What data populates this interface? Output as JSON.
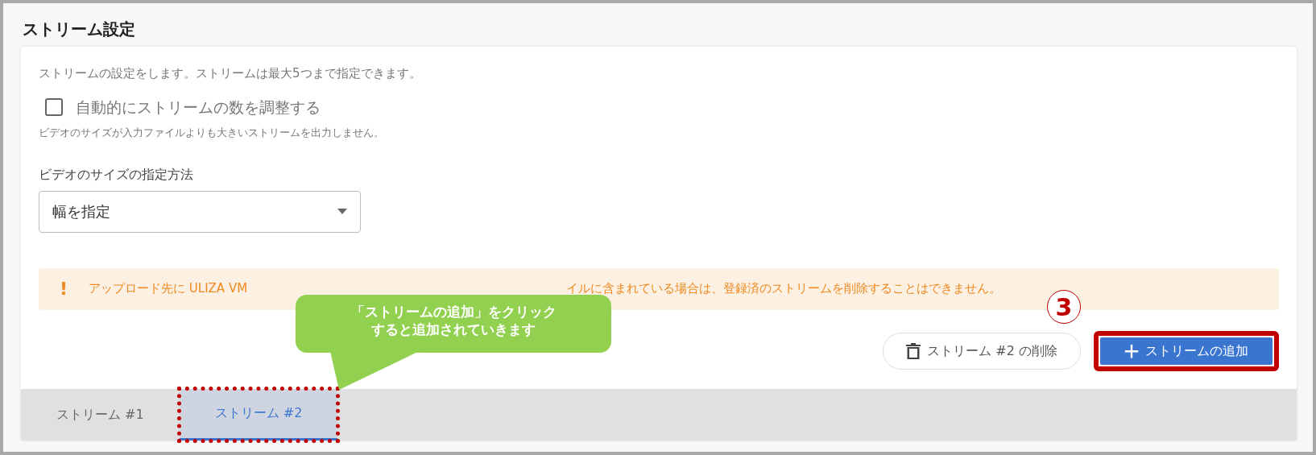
{
  "section": {
    "title": "ストリーム設定"
  },
  "description": "ストリームの設定をします。ストリームは最大5つまで指定できます。",
  "auto_adjust": {
    "label": "自動的にストリームの数を調整する",
    "checked": false,
    "hint": "ビデオのサイズが入力ファイルよりも大きいストリームを出力しません。"
  },
  "size_method": {
    "label": "ビデオのサイズの指定方法",
    "value": "幅を指定"
  },
  "warning": {
    "icon": "!",
    "text_left": "アップロード先に ULIZA VM",
    "text_right": "イルに含まれている場合は、登録済のストリームを削除することはできません。"
  },
  "buttons": [
    {
      "kind": "delete",
      "label": "ストリーム #2 の削除",
      "highlighted": false
    },
    {
      "kind": "add",
      "label": "ストリームの追加",
      "highlighted": true
    }
  ],
  "tabs": [
    {
      "label": "ストリーム #1",
      "selected": false,
      "highlighted": false
    },
    {
      "label": "ストリーム #2",
      "selected": true,
      "highlighted": true
    }
  ],
  "annotation": {
    "callout": [
      "「ストリームの追加」をクリック",
      "すると追加されていきます"
    ],
    "step": "3"
  }
}
